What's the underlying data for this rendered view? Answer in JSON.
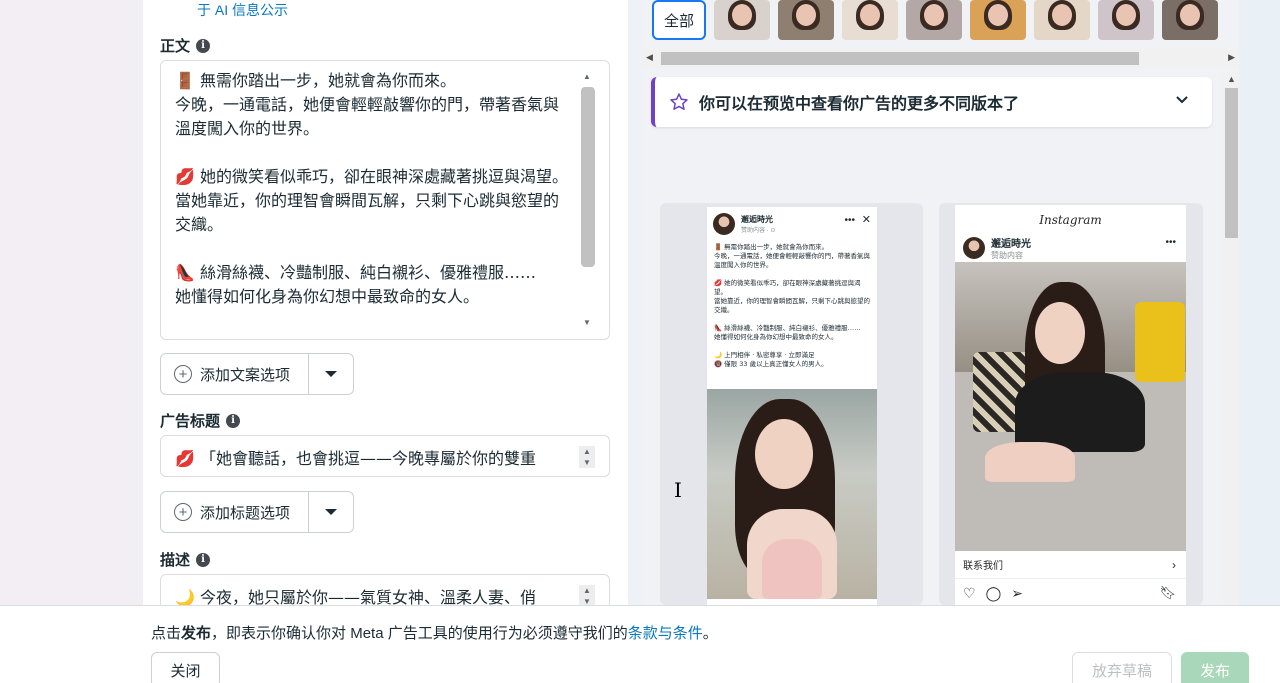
{
  "left": {
    "ai_link": "于 AI 信息公示",
    "body_label": "正文",
    "body_text": "🚪 無需你踏出一步，她就會為你而來。\n今晚，一通電話，她便會輕輕敲響你的門，帶著香氣與溫度闖入你的世界。\n\n💋 她的微笑看似乖巧，卻在眼神深處藏著挑逗與渴望。\n當她靠近，你的理智會瞬間瓦解，只剩下心跳與慾望的交織。\n\n👠 絲滑絲襪、冷豔制服、純白襯衫、優雅禮服……\n她懂得如何化身為你幻想中最致命的女人。",
    "add_text_option": "添加文案选项",
    "headline_label": "广告标题",
    "headline_value": "💋 「她會聽話，也會挑逗——今晚專屬於你的雙重",
    "add_headline_option": "添加标题选项",
    "description_label": "描述",
    "description_value": "🌙 今夜，她只屬於你——氣質女神、溫柔人妻、俏"
  },
  "right": {
    "all_chip": "全部",
    "variant_banner": "你可以在预览中查看你广告的更多不同版本了",
    "fb_preview": {
      "name": "邂逅時光",
      "sub": "赞助内容 · ⊙",
      "text": "🚪 無需你踏出一步，她就會為你而來。\n今晚，一通電話，她便會輕輕敲響你的門，帶著香氣與溫度闖入你的世界。\n\n💋 她的微笑看似乖巧，卻在眼神深處藏著挑逗與渴望。\n當她靠近，你的理智會瞬間瓦解，只剩下心跳與慾望的交織。\n\n👠 絲滑絲襪、冷豔制服、純白襯衫、優雅禮服……\n她懂得如何化身為你幻想中最致命的女人。\n\n🌙 上門相伴 · 私密尊享 · 立即滿足\n🔞 僅限 33 歲以上真正懂女人的男人。"
    },
    "ig_preview": {
      "brand": "Instagram",
      "name": "邂逅時光",
      "sub": "赞助内容",
      "cta": "联系我们"
    }
  },
  "footer": {
    "text_prefix": "点击",
    "text_bold": "发布",
    "text_middle": "，即表示你确认你对 Meta 广告工具的使用行为必须遵守我们的",
    "text_link": "条款与条件",
    "text_suffix": "。",
    "close": "关闭",
    "discard": "放弃草稿",
    "publish": "发布"
  }
}
